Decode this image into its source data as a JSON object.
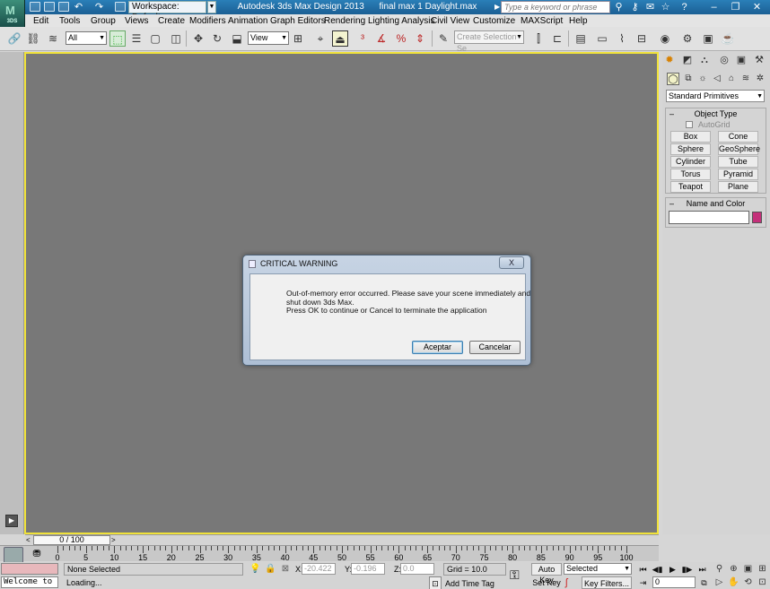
{
  "window": {
    "workspace_label": "Workspace: Default",
    "title": "Autodesk 3ds Max Design 2013      final max 1 Daylight.max",
    "search_placeholder": "Type a keyword or phrase",
    "app_icon_text": "3DS",
    "app_icon_letter": "M"
  },
  "menu": [
    "Edit",
    "Tools",
    "Group",
    "Views",
    "Create",
    "Modifiers",
    "Animation",
    "Graph Editors",
    "Rendering",
    "Lighting Analysis",
    "Civil View",
    "Customize",
    "MAXScript",
    "Help"
  ],
  "toolbar": {
    "selection_filter": "All",
    "reference_coord": "View",
    "selection_set_placeholder": "Create Selection Se"
  },
  "command_panel": {
    "category": "Standard Primitives",
    "object_type_title": "Object Type",
    "autogrid_label": "AutoGrid",
    "primitives": [
      "Box",
      "Cone",
      "Sphere",
      "GeoSphere",
      "Cylinder",
      "Tube",
      "Torus",
      "Pyramid",
      "Teapot",
      "Plane"
    ],
    "name_color_title": "Name and Color",
    "object_color": "#c4307a"
  },
  "time_slider": {
    "label": "0 / 100",
    "ticks": [
      0,
      5,
      10,
      15,
      20,
      25,
      30,
      35,
      40,
      45,
      50,
      55,
      60,
      65,
      70,
      75,
      80,
      85,
      90,
      95,
      100
    ]
  },
  "status": {
    "welcome": "Welcome to M",
    "selection": "None Selected",
    "loading": "Loading...",
    "x_label": "X:",
    "x_value": "-20.422",
    "y_label": "Y:",
    "y_value": "-0.196",
    "z_label": "Z:",
    "z_value": "0.0",
    "grid": "Grid = 10.0",
    "add_time_tag": "Add Time Tag",
    "auto_key": "Auto Key",
    "set_key": "Set Key",
    "key_mode": "Selected",
    "key_filters": "Key Filters...",
    "frame": "0"
  },
  "dialog": {
    "title": "CRITICAL WARNING",
    "close": "X",
    "message_lines": [
      "Out-of-memory error occurred. Please save your scene immediately and",
      "shut down 3ds Max.",
      "Press OK to continue or Cancel to terminate the application"
    ],
    "ok_label": "Aceptar",
    "cancel_label": "Cancelar"
  }
}
